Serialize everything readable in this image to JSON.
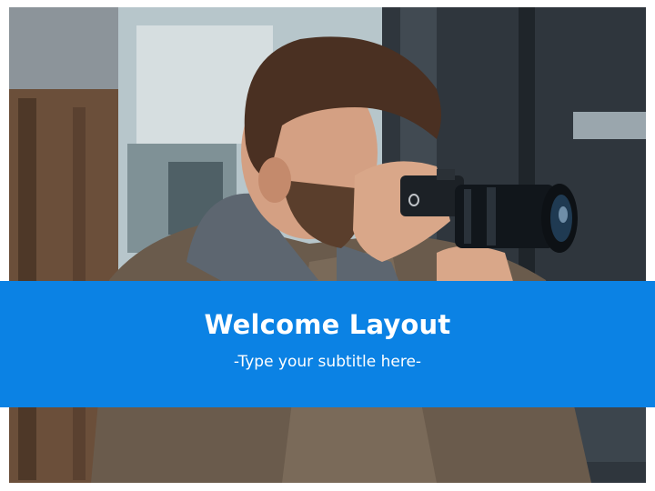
{
  "slide": {
    "title": "Welcome Layout",
    "subtitle": "-Type your subtitle here-"
  },
  "colors": {
    "band": "#0b82e4",
    "text": "#ffffff"
  },
  "icons": {
    "background_photo": "photographer-with-camera-photo"
  }
}
